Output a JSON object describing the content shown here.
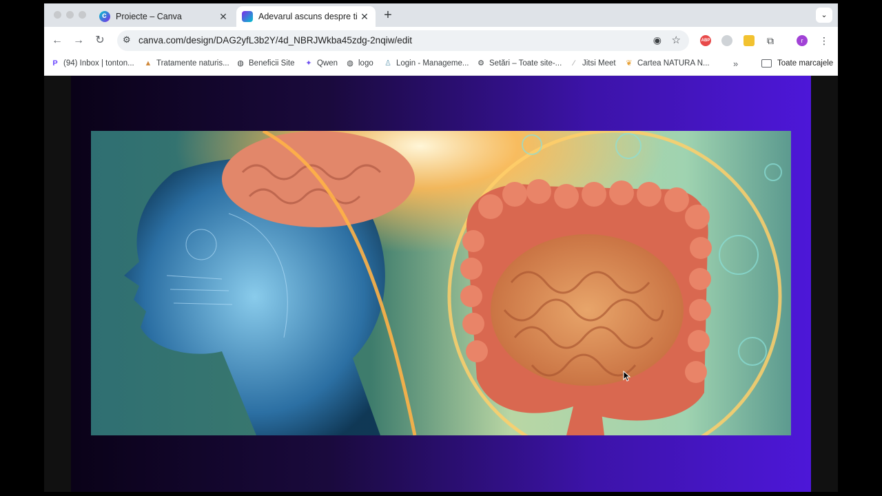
{
  "browser": {
    "tabs": [
      {
        "title": "Proiecte – Canva",
        "favicon": "canva-icon",
        "active": false
      },
      {
        "title": "Adevarul ascuns despre tine",
        "favicon": "canva-design-icon",
        "active": true
      }
    ],
    "newtab_glyph": "+",
    "tabsearch_glyph": "⌄",
    "address": "canva.com/design/DAG2yfL3b2Y/4d_NBRJWkba45zdg-2nqiw/edit",
    "profile_initial": "r",
    "abp_label": "ABP"
  },
  "bookmarks": [
    {
      "label": "(94) Inbox | tonton...",
      "icon": "proton-icon"
    },
    {
      "label": "Tratamente naturis...",
      "icon": "leaf-icon"
    },
    {
      "label": "Beneficii Site",
      "icon": "globe-icon"
    },
    {
      "label": "Qwen",
      "icon": "qwen-icon"
    },
    {
      "label": "logo",
      "icon": "globe-icon"
    },
    {
      "label": "Login - Manageme...",
      "icon": "user-icon"
    },
    {
      "label": "Setări – Toate site-...",
      "icon": "gear-icon"
    },
    {
      "label": "Jitsi Meet",
      "icon": "jitsi-icon"
    },
    {
      "label": "Cartea NATURA N...",
      "icon": "book-icon"
    }
  ],
  "bookmarks_overflow": "»",
  "all_bookmarks": "Toate marcajele",
  "colors": {
    "slide_dark": "#0a0218",
    "slide_accent": "#4d17d8",
    "canva_teal": "#00c4cc",
    "canva_purple": "#7d2ae8"
  }
}
